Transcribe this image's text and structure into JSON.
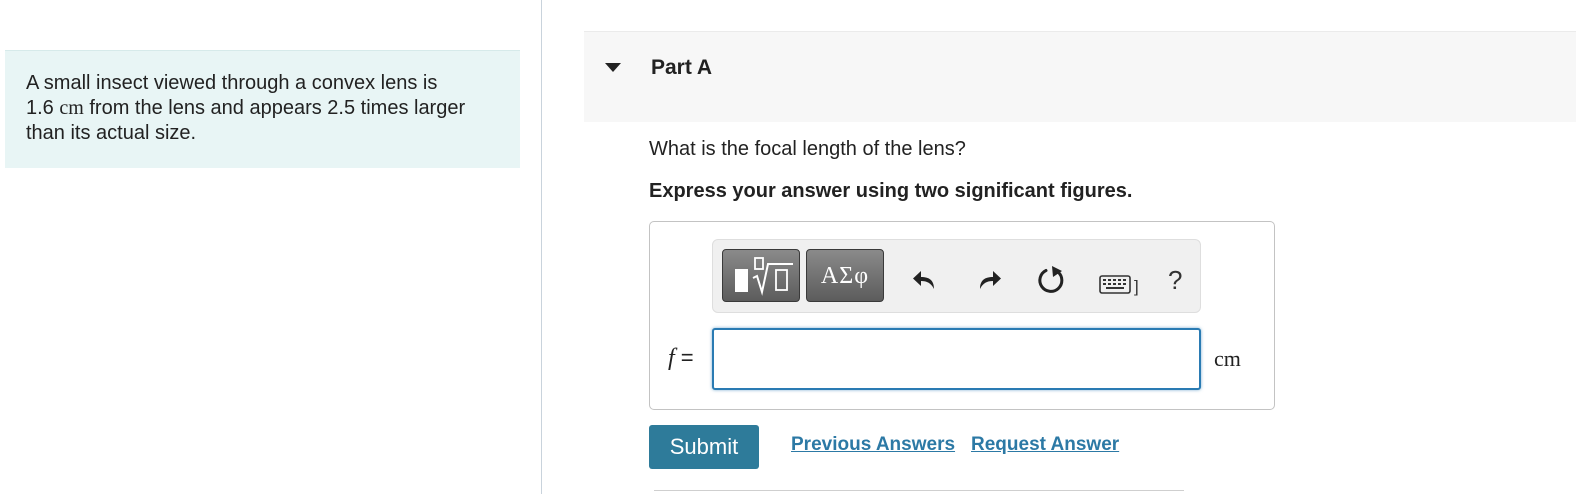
{
  "problem": {
    "text_1": "A small insect viewed through a convex lens is",
    "distance_value": "1.6",
    "distance_unit": "cm",
    "text_2": "from the lens and appears 2.5 times larger",
    "text_3": "than its actual size."
  },
  "part": {
    "title": "Part A",
    "question": "What is the focal length of the lens?",
    "instruction": "Express your answer using two significant figures."
  },
  "toolbar": {
    "templates_icon": "fraction-radical-icon",
    "symbols_label": "ΑΣφ",
    "undo_icon": "undo-icon",
    "redo_icon": "redo-icon",
    "reset_icon": "reset-icon",
    "keyboard_icon": "keyboard-icon",
    "keyboard_suffix": "]",
    "help_label": "?"
  },
  "answer": {
    "variable": "f",
    "equals": " =",
    "value": "",
    "unit": "cm"
  },
  "actions": {
    "submit_label": "Submit",
    "previous_answers_label": "Previous Answers",
    "request_answer_label": "Request Answer"
  },
  "colors": {
    "problem_background": "#e8f5f5",
    "submit_background": "#2e7b9a",
    "link_color": "#2c79a5",
    "input_border": "#2a7bb3"
  }
}
